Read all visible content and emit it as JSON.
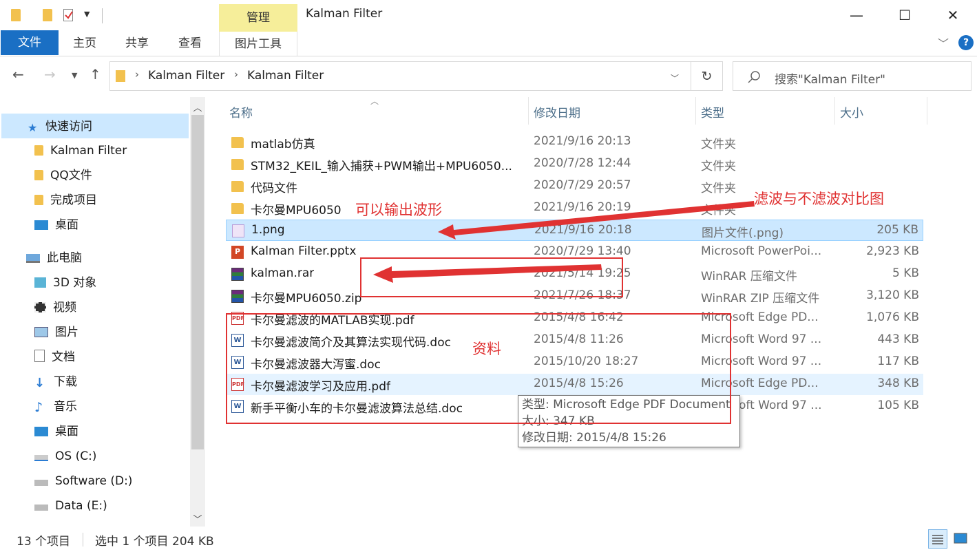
{
  "window": {
    "title": "Kalman Filter",
    "context_tab_group": "管理",
    "controls": {
      "minimize": "—",
      "maximize": "☐",
      "close": "✕"
    }
  },
  "ribbon": {
    "file_tab": "文件",
    "tabs": [
      "主页",
      "共享",
      "查看"
    ],
    "context_tab": "图片工具",
    "help": "?"
  },
  "address_bar": {
    "segments": [
      "Kalman Filter",
      "Kalman Filter"
    ],
    "search_placeholder": "搜索\"Kalman Filter\""
  },
  "sidebar": {
    "quick_access": "快速访问",
    "quick_items": [
      "Kalman Filter",
      "QQ文件",
      "完成项目",
      "桌面"
    ],
    "this_pc": "此电脑",
    "pc_items": [
      "3D 对象",
      "视频",
      "图片",
      "文档",
      "下载",
      "音乐",
      "桌面",
      "OS (C:)",
      "Software (D:)",
      "Data (E:)"
    ]
  },
  "columns": {
    "name": "名称",
    "date": "修改日期",
    "type": "类型",
    "size": "大小"
  },
  "files": [
    {
      "name": "matlab仿真",
      "date": "2021/9/16 20:13",
      "type": "文件夹",
      "size": "",
      "icon": "folder-icon"
    },
    {
      "name": "STM32_KEIL_输入捕获+PWM输出+MPU6050...",
      "date": "2020/7/28 12:44",
      "type": "文件夹",
      "size": "",
      "icon": "folder-icon"
    },
    {
      "name": "代码文件",
      "date": "2020/7/29 20:57",
      "type": "文件夹",
      "size": "",
      "icon": "folder-icon"
    },
    {
      "name": "卡尔曼MPU6050",
      "date": "2021/9/16 20:19",
      "type": "文件夹",
      "size": "",
      "icon": "folder-icon"
    },
    {
      "name": "1.png",
      "date": "2021/9/16 20:18",
      "type": "图片文件(.png)",
      "size": "205 KB",
      "icon": "png-file-icon"
    },
    {
      "name": "Kalman Filter.pptx",
      "date": "2020/7/29 13:40",
      "type": "Microsoft PowerPoi...",
      "size": "2,923 KB",
      "icon": "pptx-file-icon"
    },
    {
      "name": "kalman.rar",
      "date": "2021/5/14 19:25",
      "type": "WinRAR 压缩文件",
      "size": "5 KB",
      "icon": "rar-file-icon"
    },
    {
      "name": "卡尔曼MPU6050.zip",
      "date": "2021/7/26 18:37",
      "type": "WinRAR ZIP 压缩文件",
      "size": "3,120 KB",
      "icon": "zip-file-icon"
    },
    {
      "name": "卡尔曼滤波的MATLAB实现.pdf",
      "date": "2015/4/8 16:42",
      "type": "Microsoft Edge PD...",
      "size": "1,076 KB",
      "icon": "pdf-file-icon"
    },
    {
      "name": "卡尔曼滤波简介及其算法实现代码.doc",
      "date": "2015/4/8 11:26",
      "type": "Microsoft Word 97 ...",
      "size": "443 KB",
      "icon": "doc-file-icon"
    },
    {
      "name": "卡尔曼滤波器大泻蜜.doc",
      "date": "2015/10/20 18:27",
      "type": "Microsoft Word 97 ...",
      "size": "117 KB",
      "icon": "doc-file-icon"
    },
    {
      "name": "卡尔曼滤波学习及应用.pdf",
      "date": "2015/4/8 15:26",
      "type": "Microsoft Edge PD...",
      "size": "348 KB",
      "icon": "pdf-file-icon"
    },
    {
      "name": "新手平衡小车的卡尔曼滤波算法总结.doc",
      "date": "",
      "type": "oft Word 97 ...",
      "size": "105 KB",
      "icon": "doc-file-icon"
    }
  ],
  "tooltip": {
    "type_line": "类型: Microsoft Edge PDF Document",
    "size_line": "大小: 347 KB",
    "date_line": "修改日期: 2015/4/8 15:26"
  },
  "annotations": {
    "png_label": "可以输出波形",
    "compare_label": "滤波与不滤波对比图",
    "docs_label": "资料",
    "color": "#e03232"
  },
  "status_bar": {
    "item_count": "13 个项目",
    "selection": "选中 1 个项目  204 KB"
  }
}
